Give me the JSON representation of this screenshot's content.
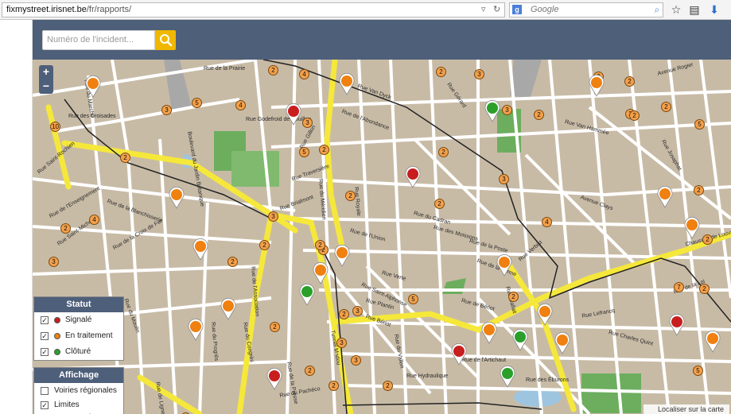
{
  "browser": {
    "url_host": "fixmystreet.irisnet.be",
    "url_path": "/fr/rapports/",
    "search_engine_badge": "g",
    "search_placeholder": "Google"
  },
  "header": {
    "incident_placeholder": "Numéro de l'incident..."
  },
  "legend": {
    "status": {
      "title": "Statut",
      "items": [
        {
          "label": "Signalé",
          "color": "#c81e1e",
          "checked": true
        },
        {
          "label": "En traitement",
          "color": "#f08010",
          "checked": true
        },
        {
          "label": "Clôturé",
          "color": "#2aa02a",
          "checked": true
        }
      ]
    },
    "display": {
      "title": "Affichage",
      "items": [
        {
          "label": "Voiries régionales",
          "checked": false
        },
        {
          "label": "Limites communales",
          "checked": true
        }
      ]
    }
  },
  "map": {
    "locate_label": "Localiser sur la carte",
    "zoom_in": "+",
    "zoom_out": "−",
    "colors": {
      "base": "#c8bba6",
      "street": "#ffffff",
      "major": "#f5e83a",
      "park": "#6cae5e",
      "water": "#9ec5e0",
      "boundary": "#222222"
    },
    "street_labels": [
      "Rue de la Prairie",
      "Rue Van Dyck",
      "Rue Gérard",
      "Rue de l'Abondance",
      "Rue Godefroid de Bouillon",
      "Rue Gillon",
      "Rue Traversière",
      "Rue des Croisades",
      "Rue Saint-Rochien",
      "Rue de la Blanchisserie",
      "Rue Brialmont",
      "Rue de l'Union",
      "Rue du Cadran",
      "Rue des Moissons",
      "Rue de la Poste",
      "Rue du Marché",
      "Rue Royale",
      "Rue du Méridien",
      "Rue Verte",
      "Rue Plantin",
      "Rue Saint-Michel",
      "Rue de la Croix de Fer",
      "Rue du Congrès",
      "Rue du Progrès",
      "Rue de l'Association",
      "Avenue Clays",
      "Rue Van Hammée",
      "Rue Josaphat",
      "Avenue Rogier",
      "Rue du Moulin",
      "Rue Hydraulique",
      "Rue de l'Artichaut",
      "Rue des Éburons",
      "Rue Lefrancq",
      "Rue Charles Quint",
      "Chaussée de Louvain",
      "Tunnel Madou",
      "Rue de la Presse",
      "Rue du Pachéco",
      "Rue du Vallon",
      "Rue Saint-Alphonse",
      "Rue de la Ferme",
      "Rue Verbist",
      "Rue Bériot",
      "Rue Gallait",
      "Boulevard du Jardin Botanique",
      "Rue de l'Enseignement",
      "Rue de Ligne",
      "Rue de la Loi",
      "Rue de Bériot"
    ],
    "cluster_counts": [
      "2",
      "4",
      "3",
      "5",
      "4",
      "10",
      "2",
      "3",
      "2",
      "5",
      "2",
      "4",
      "2",
      "2",
      "2",
      "3",
      "2",
      "3",
      "2",
      "3",
      "2",
      "2",
      "5",
      "3",
      "2",
      "4",
      "3",
      "2",
      "3",
      "2",
      "3",
      "2",
      "2",
      "3",
      "2",
      "2",
      "2",
      "5",
      "2",
      "3",
      "2",
      "7",
      "2",
      "2",
      "3",
      "4",
      "2",
      "2",
      "7",
      "5"
    ]
  }
}
